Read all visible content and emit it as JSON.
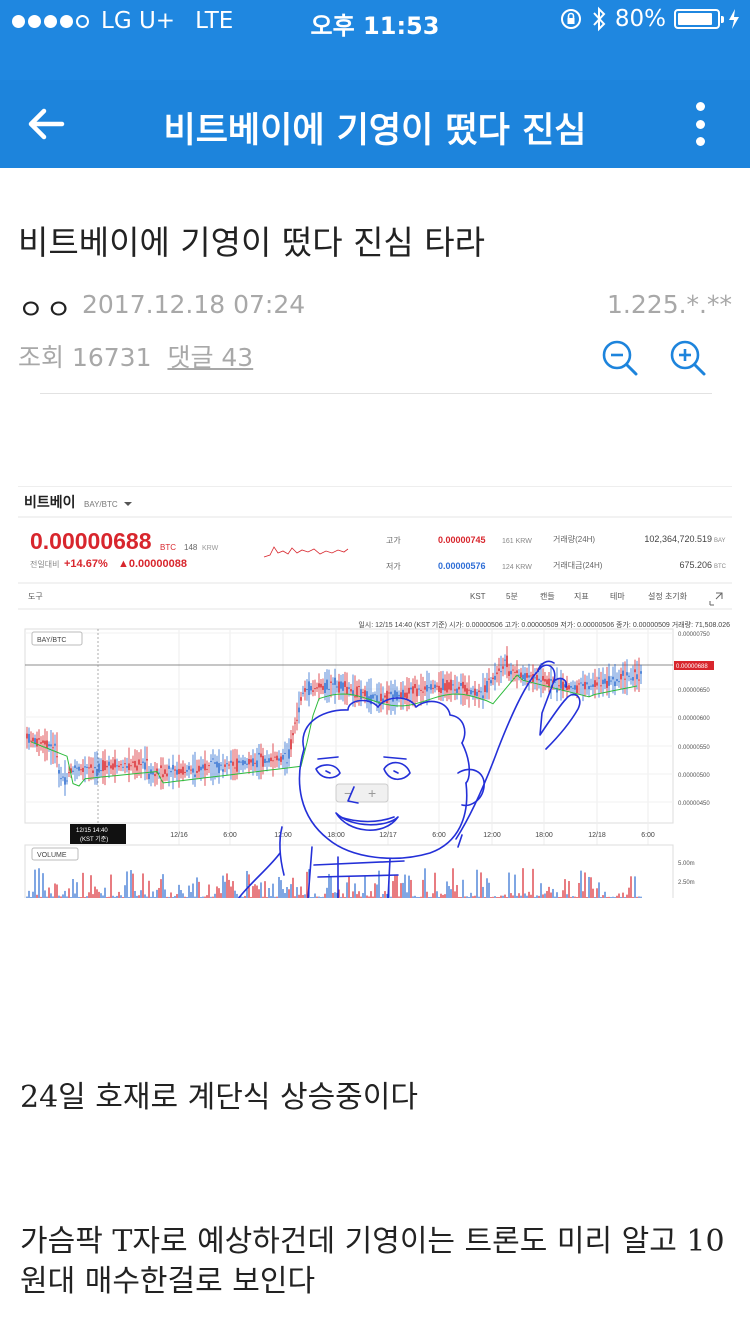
{
  "status_bar": {
    "carrier": "LG U+",
    "network": "LTE",
    "time": "오후 11:53",
    "battery": "80%"
  },
  "app_bar": {
    "title": "비트베이에 기영이 떴다 진심",
    "back_icon": "back-arrow-icon",
    "more_icon": "more-vertical-icon"
  },
  "post": {
    "title": "비트베이에 기영이 떴다 진심 타라",
    "author": "ㅇㅇ",
    "date": "2017.12.18 07:24",
    "ip": "1.225.*.**",
    "views": "조회 16731",
    "comments": "댓글 43",
    "zoom_out_icon": "zoom-out-icon",
    "zoom_in_icon": "zoom-in-icon"
  },
  "embedded_image": {
    "exchange": "비트베이",
    "pair": "BAY/BTC",
    "price": "0.00000688",
    "price_unit": "BTC",
    "price_krw": "148",
    "krw": "KRW",
    "change_label": "전일대비",
    "change_pct": "+14.67%",
    "change_abs": "▲0.00000088",
    "high_label": "고가",
    "high": "0.00000745",
    "high_krw": "161 KRW",
    "low_label": "저가",
    "low": "0.00000576",
    "low_krw": "124 KRW",
    "volume_label": "거래량(24H)",
    "volume": "102,364,720.519",
    "volume_unit": "BAY",
    "amount_label": "거래대금(24H)",
    "amount": "675.206",
    "amount_unit": "BTC",
    "toolbar_left": "도구",
    "toolbar_items": [
      "KST",
      "5분",
      "캔들",
      "지표",
      "테마",
      "설정 초기화"
    ],
    "info_line": "일시: 12/15 14:40 (KST 기준) 시가: 0.00000506 고가: 0.00000509 저가: 0.00000506 종가: 0.00000509 거래량: 71,508.026",
    "panel_label": "BAY/BTC",
    "volume_panel_label": "VOLUME",
    "x_labels": [
      "12/16",
      "6:00",
      "12:00",
      "18:00",
      "12/17",
      "6:00",
      "12:00",
      "18:00",
      "12/18",
      "6:00"
    ],
    "y_labels": [
      "0.00000750",
      "0.00000650",
      "0.00000600",
      "0.00000550",
      "0.00000500",
      "0.00000450"
    ],
    "current_price_tag": "0.00000688",
    "cursor_tag_1": "12/15 14:40",
    "cursor_tag_2": "(KST 기준)",
    "vol_y_labels": [
      "5.00m",
      "2.50m"
    ]
  },
  "body": {
    "p1": "24일 호재로 계단식 상승중이다",
    "p2": "가슴팍 T자로 예상하건데 기영이는 트론도 미리 알고 10원대 매수한걸로 보인다"
  },
  "colors": {
    "primary": "#1d84dc",
    "status_bar": "#1f87e0",
    "price_red": "#d8262d",
    "low_blue": "#2f6ed6",
    "doodle_blue": "#2430d8"
  }
}
